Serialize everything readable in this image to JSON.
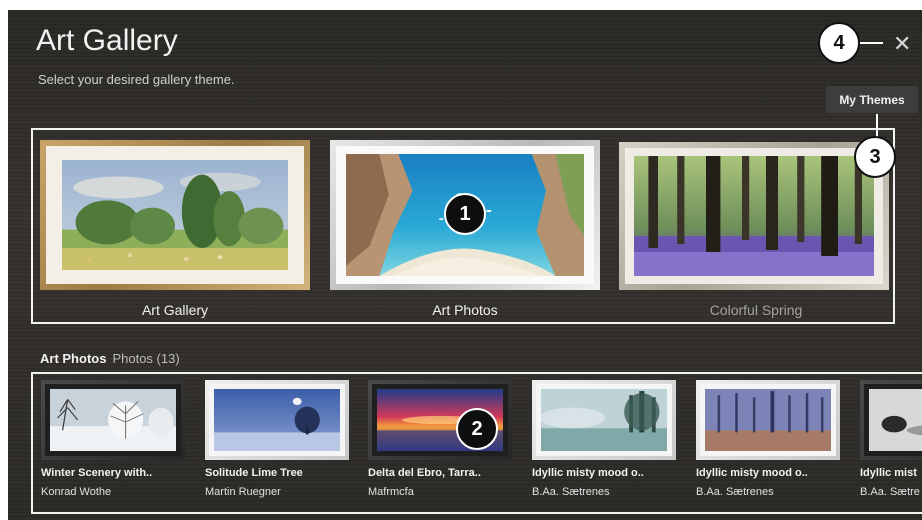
{
  "header": {
    "title": "Art Gallery",
    "subtitle": "Select your desired gallery theme.",
    "close_glyph": "✕",
    "my_themes_label": "My Themes"
  },
  "themes": [
    {
      "label": "Art Gallery",
      "frame": "gold",
      "focused": false
    },
    {
      "label": "Art Photos",
      "frame": "silver",
      "focused": true
    },
    {
      "label": "Colorful Spring",
      "frame": "platinum",
      "focused": false
    }
  ],
  "collection": {
    "title": "Art Photos",
    "count_label": "Photos (13)",
    "items": [
      {
        "title": "Winter Scenery with..",
        "artist": "Konrad Wothe"
      },
      {
        "title": "Solitude Lime Tree",
        "artist": "Martin Ruegner"
      },
      {
        "title": "Delta del Ebro, Tarra..",
        "artist": "Mafrmcfa"
      },
      {
        "title": "Idyllic misty mood o..",
        "artist": "B.Aa. Sætrenes"
      },
      {
        "title": "Idyllic misty mood o..",
        "artist": "B.Aa. Sætrenes"
      },
      {
        "title": "Idyllic mist",
        "artist": "B.Aa. Sætre"
      }
    ]
  },
  "callouts": [
    "1",
    "2",
    "3",
    "4"
  ],
  "colors": {
    "accent_outline": "#f2f2f2",
    "background": "#2f2c29"
  }
}
